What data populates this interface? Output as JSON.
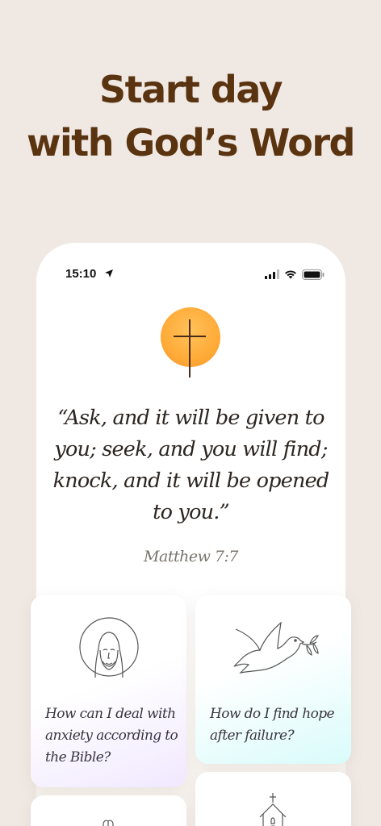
{
  "headline": {
    "line1": "Start day",
    "line2": "with God’s Word"
  },
  "status_bar": {
    "time": "15:10"
  },
  "verse": {
    "text": "“Ask, and it will be given to you; seek, and you will find; knock, and it will be opened to you.”",
    "reference": "Matthew 7:7"
  },
  "cards": [
    {
      "title": "How can I deal with anxiety according to the Bible?",
      "icon": "jesus-icon"
    },
    {
      "title": "How do I find hope after failure?",
      "icon": "dove-icon"
    },
    {
      "title": "",
      "icon": "praying-hands-icon"
    },
    {
      "title": "",
      "icon": "church-icon"
    }
  ],
  "colors": {
    "background": "#f0e9e3",
    "headline": "#5a3410",
    "sun": "#ffab38",
    "card_purple_tint": "#f1e8ff",
    "card_cyan_tint": "#d9fbfb"
  }
}
